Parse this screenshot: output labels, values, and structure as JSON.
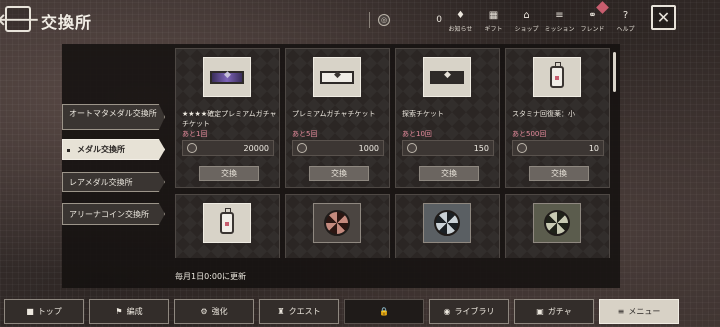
{
  "header": {
    "title": "交換所",
    "currency_value": "0",
    "nav": [
      {
        "label": "お知らせ",
        "icon": "bell-icon",
        "glyph": "♦"
      },
      {
        "label": "ギフト",
        "icon": "gift-icon",
        "glyph": "▦"
      },
      {
        "label": "ショップ",
        "icon": "shop-icon",
        "glyph": "⌂"
      },
      {
        "label": "ミッション",
        "icon": "mission-icon",
        "glyph": "≡"
      },
      {
        "label": "フレンド",
        "icon": "friend-icon",
        "glyph": "⚭"
      },
      {
        "label": "ヘルプ",
        "icon": "help-icon",
        "glyph": "?"
      }
    ]
  },
  "sidebar": {
    "items": [
      {
        "label": "オートマタメダル交換所",
        "active": false
      },
      {
        "label": "メダル交換所",
        "active": true
      },
      {
        "label": "レアメダル交換所",
        "active": false
      },
      {
        "label": "アリーナコイン交換所",
        "active": false
      }
    ]
  },
  "items": [
    {
      "name": "★★★★確定プレミアムガチャチケット",
      "remaining": "あと1回",
      "price": "20000",
      "button": "交換",
      "icon": "ticket-purple"
    },
    {
      "name": "プレミアムガチャチケット",
      "remaining": "あと5回",
      "price": "1000",
      "button": "交換",
      "icon": "ticket-plain"
    },
    {
      "name": "探索チケット",
      "remaining": "あと10回",
      "price": "150",
      "button": "交換",
      "icon": "ticket-dark"
    },
    {
      "name": "スタミナ回復薬：小",
      "remaining": "あと500回",
      "price": "10",
      "button": "交換",
      "icon": "stamina-potion"
    }
  ],
  "footnote": "毎月1日0:00に更新",
  "bottom_tabs": [
    {
      "label": "トップ",
      "icon": "top-icon",
      "glyph": "■"
    },
    {
      "label": "編成",
      "icon": "formation-icon",
      "glyph": "⚑"
    },
    {
      "label": "強化",
      "icon": "enhance-icon",
      "glyph": "⚙"
    },
    {
      "label": "クエスト",
      "icon": "quest-icon",
      "glyph": "♜"
    },
    {
      "label": "",
      "icon": "lock-icon",
      "glyph": "🔒"
    },
    {
      "label": "ライブラリ",
      "icon": "library-icon",
      "glyph": "◉"
    },
    {
      "label": "ガチャ",
      "icon": "gacha-icon",
      "glyph": "▣"
    },
    {
      "label": "メニュー",
      "icon": "menu-icon",
      "glyph": "≡"
    }
  ]
}
